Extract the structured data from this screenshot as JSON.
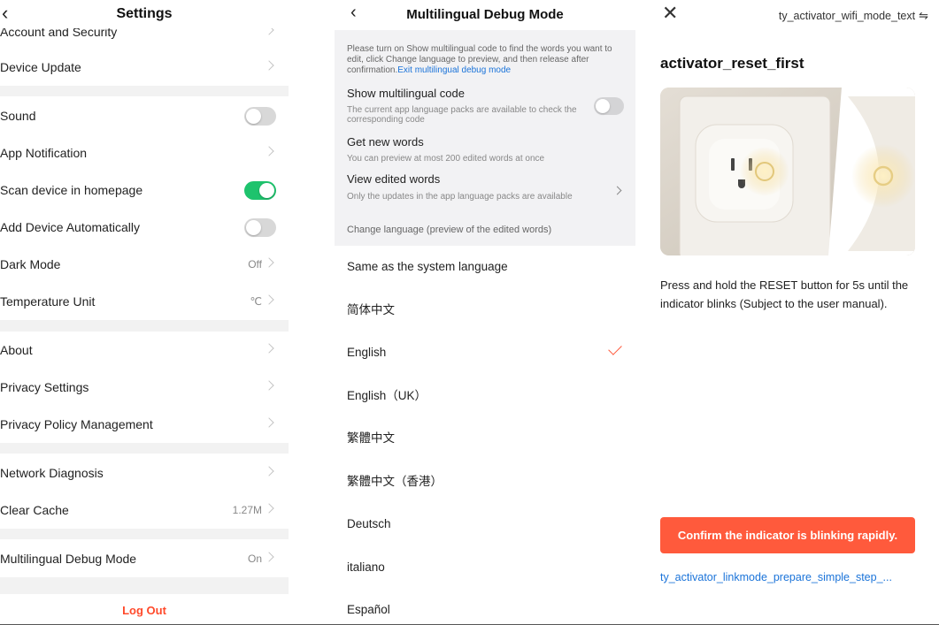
{
  "settings": {
    "title": "Settings",
    "rows": [
      {
        "label": "Account and Security",
        "value": "",
        "kind": "chevron"
      },
      {
        "label": "Device Update",
        "value": "",
        "kind": "chevron"
      },
      {
        "label": "Sound",
        "value": "",
        "kind": "toggle",
        "on": false
      },
      {
        "label": "App Notification",
        "value": "",
        "kind": "chevron"
      },
      {
        "label": "Scan device in homepage",
        "value": "",
        "kind": "toggle",
        "on": true
      },
      {
        "label": "Add Device Automatically",
        "value": "",
        "kind": "toggle",
        "on": false
      },
      {
        "label": "Dark Mode",
        "value": "Off",
        "kind": "chevron"
      },
      {
        "label": "Temperature Unit",
        "value": "℃",
        "kind": "chevron"
      },
      {
        "label": "About",
        "value": "",
        "kind": "chevron"
      },
      {
        "label": "Privacy Settings",
        "value": "",
        "kind": "chevron"
      },
      {
        "label": "Privacy Policy Management",
        "value": "",
        "kind": "chevron"
      },
      {
        "label": "Network Diagnosis",
        "value": "",
        "kind": "chevron"
      },
      {
        "label": "Clear Cache",
        "value": "1.27M",
        "kind": "chevron"
      },
      {
        "label": "Multilingual Debug Mode",
        "value": "On",
        "kind": "chevron"
      }
    ],
    "logout": "Log Out",
    "toggle_on_color": "#1ec36d"
  },
  "debug": {
    "title": "Multilingual Debug Mode",
    "notice": "Please turn on Show multilingual code to find the words you want to edit, click Change language to preview, and then release after confirmation.",
    "notice_link": "Exit multilingual debug mode",
    "show_code_title": "Show multilingual code",
    "show_code_sub": "The current app language packs are available to check the corresponding code",
    "show_code_on": false,
    "new_words_title": "Get new words",
    "new_words_sub": "You can preview at most 200 edited words at once",
    "view_edited_title": "View edited words",
    "view_edited_sub": "Only the updates in the app language packs are available",
    "change_language_header": "Change language (preview of the edited words)",
    "languages": [
      {
        "label": "Same as the system language",
        "selected": false
      },
      {
        "label": "简体中文",
        "selected": false
      },
      {
        "label": "English",
        "selected": true
      },
      {
        "label": "English（UK）",
        "selected": false
      },
      {
        "label": "繁體中文",
        "selected": false
      },
      {
        "label": "繁體中文（香港）",
        "selected": false
      },
      {
        "label": "Deutsch",
        "selected": false
      },
      {
        "label": "italiano",
        "selected": false
      },
      {
        "label": "Español",
        "selected": false
      }
    ],
    "accent_color": "#ff5a3c"
  },
  "activator": {
    "header_title": "ty_activator_wifi_mode_text",
    "switch_icon": "⇋",
    "heading": "activator_reset_first",
    "description": "Press and hold the RESET button for 5s until the indicator blinks (Subject to the user manual).",
    "confirm_button": "Confirm the indicator is blinking rapidly.",
    "bottom_link": "ty_activator_linkmode_prepare_simple_step_...",
    "button_color": "#ff5a3c"
  }
}
